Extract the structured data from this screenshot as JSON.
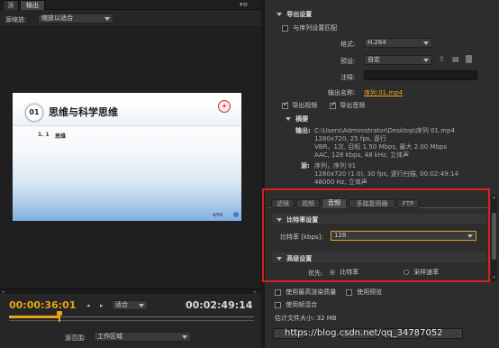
{
  "tabs": {
    "source": "源",
    "output": "输出"
  },
  "source_scaling": {
    "label": "源缩放:",
    "value": "缩放以适合"
  },
  "slide": {
    "number": "01",
    "title": "思维与科学思维",
    "sub_number": "1. 1",
    "sub_title": "思维",
    "page": "4/69"
  },
  "timeline": {
    "current_time": "00:00:36:01",
    "fit_value": "适合",
    "duration": "00:02:49:14",
    "source_range_label": "源范围:",
    "source_range_value": "工作区域"
  },
  "export_settings": {
    "title": "导出设置",
    "match_sequence": "与序列设置匹配",
    "format_label": "格式:",
    "format_value": "H.264",
    "preset_label": "预设:",
    "preset_value": "自定",
    "comments_label": "注释:",
    "comments_value": "",
    "output_name_label": "输出名称:",
    "output_name_value": "序列 01.mp4",
    "export_video": "导出视频",
    "export_audio": "导出音频"
  },
  "summary": {
    "title": "摘要",
    "output_label": "输出:",
    "output_lines": [
      "C:\\Users\\Administrator\\Desktop\\序列 01.mp4",
      "1280x720, 25 fps, 逐行",
      "VBR，1次, 目标 1.50 Mbps, 最大 2.00 Mbps",
      "AAC, 128 kbps, 48 kHz, 立体声"
    ],
    "source_label": "源:",
    "source_lines": [
      "序列，序列 01",
      "1280x720 (1.0), 30 fps, 逐行扫描, 00:02:49:14",
      "48000 Hz, 立体声"
    ]
  },
  "settings_tabs": [
    "滤镜",
    "视频",
    "音频",
    "多路复用器",
    "FTP"
  ],
  "bitrate": {
    "title": "比特率设置",
    "label": "比特率 [kbps]:",
    "value": "128"
  },
  "advanced": {
    "title": "高级设置",
    "priority_label": "优先:",
    "option_bitrate": "比特率",
    "option_samplerate": "采样速率"
  },
  "bottom": {
    "max_render_quality": "使用最高渲染质量",
    "use_preview": "使用预览",
    "frame_blending": "使用帧混合",
    "estimated_size": "估计文件大小: 32 MB"
  },
  "watermark": "https://blog.csdn.net/qq_34787052",
  "colors": {
    "accent_orange": "#e8a318",
    "highlight_red": "#d9201f"
  }
}
